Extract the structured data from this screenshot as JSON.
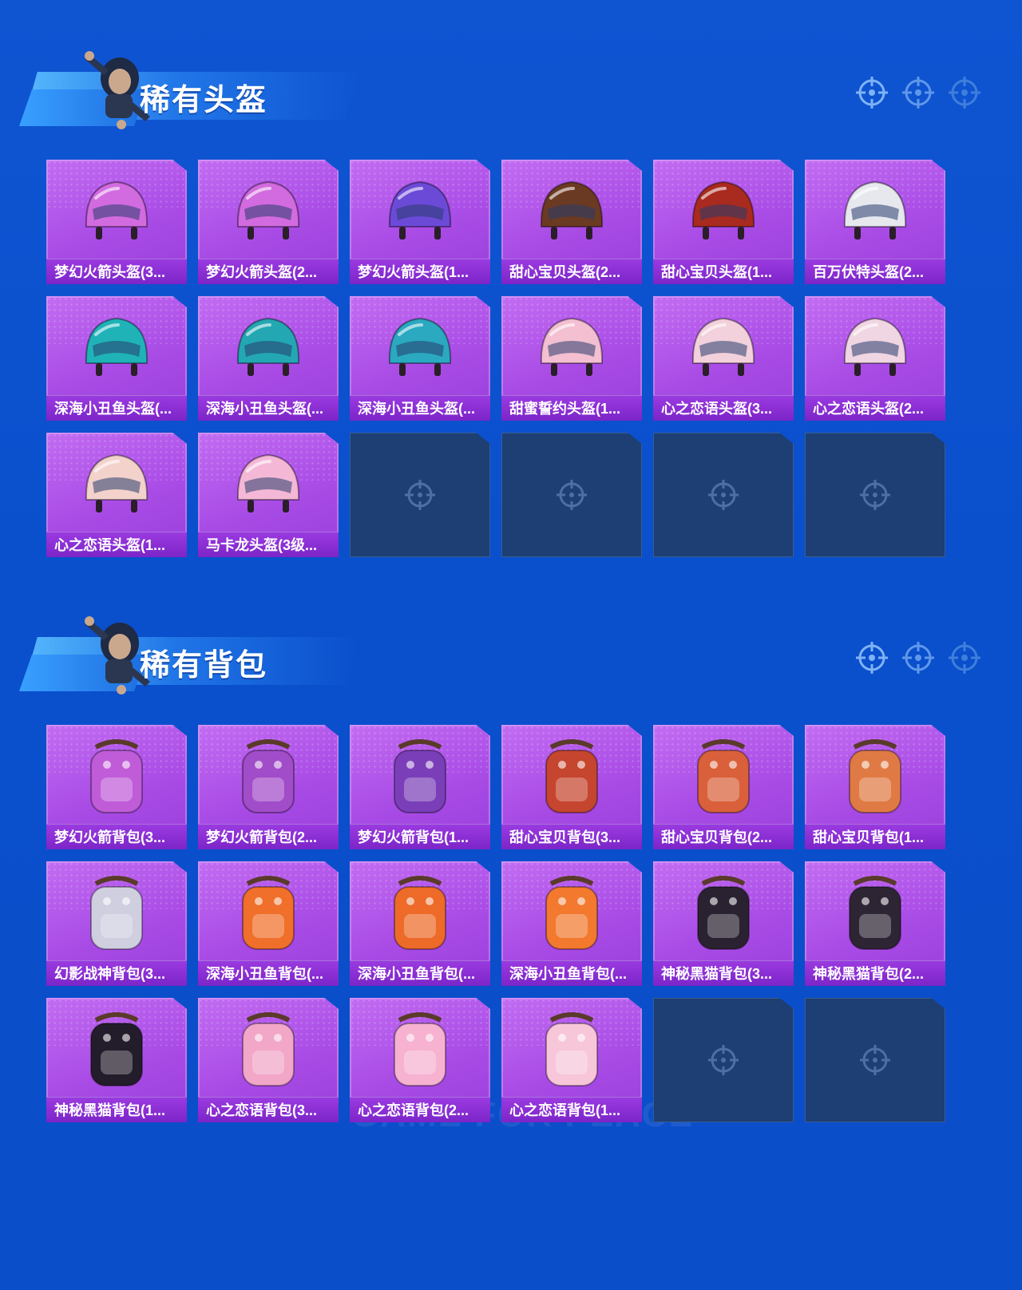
{
  "sections": [
    {
      "title": "稀有头盔",
      "items": [
        {
          "label": "梦幻火箭头盔(3...",
          "icon": "pink-rocket-helmet-icon",
          "color": "#d36be0"
        },
        {
          "label": "梦幻火箭头盔(2...",
          "icon": "pink-rocket-helmet-icon",
          "color": "#d36be0"
        },
        {
          "label": "梦幻火箭头盔(1...",
          "icon": "purple-open-helmet-icon",
          "color": "#6c4ad8"
        },
        {
          "label": "甜心宝贝头盔(2...",
          "icon": "chocolate-cake-helmet-icon",
          "color": "#6b3a22"
        },
        {
          "label": "甜心宝贝头盔(1...",
          "icon": "red-cherry-helmet-icon",
          "color": "#a92a1e"
        },
        {
          "label": "百万伏特头盔(2...",
          "icon": "white-cat-helmet-icon",
          "color": "#e6e8ee"
        },
        {
          "label": "深海小丑鱼头盔(...",
          "icon": "teal-level3-helmet-icon",
          "color": "#1fb3b8"
        },
        {
          "label": "深海小丑鱼头盔(...",
          "icon": "teal-level2-helmet-icon",
          "color": "#23a7b3"
        },
        {
          "label": "深海小丑鱼头盔(...",
          "icon": "teal-open-helmet-icon",
          "color": "#2aa9c0"
        },
        {
          "label": "甜蜜誓约头盔(1...",
          "icon": "pink-open-helmet-icon",
          "color": "#f3bfd1"
        },
        {
          "label": "心之恋语头盔(3...",
          "icon": "pink-shell-level3-helmet-icon",
          "color": "#f2d0dc"
        },
        {
          "label": "心之恋语头盔(2...",
          "icon": "pink-shell-level2-helmet-icon",
          "color": "#f0d6e2"
        },
        {
          "label": "心之恋语头盔(1...",
          "icon": "cream-open-helmet-icon",
          "color": "#f3d2cc"
        },
        {
          "label": "马卡龙头盔(3级...",
          "icon": "macaron-helmet-icon",
          "color": "#f4b8d6"
        }
      ],
      "empty_slots": 4
    },
    {
      "title": "稀有背包",
      "items": [
        {
          "label": "梦幻火箭背包(3...",
          "icon": "rocket-backpack-icon",
          "color": "#c05cd8"
        },
        {
          "label": "梦幻火箭背包(2...",
          "icon": "rocket-backpack-icon",
          "color": "#a14cc8"
        },
        {
          "label": "梦幻火箭背包(1...",
          "icon": "rocket-backpack-icon",
          "color": "#7a3fb8"
        },
        {
          "label": "甜心宝贝背包(3...",
          "icon": "cake-backpack-icon",
          "color": "#c5452e"
        },
        {
          "label": "甜心宝贝背包(2...",
          "icon": "cake-backpack-icon",
          "color": "#d9603a"
        },
        {
          "label": "甜心宝贝背包(1...",
          "icon": "cupcake-backpack-icon",
          "color": "#e07a45"
        },
        {
          "label": "幻影战神背包(3...",
          "icon": "phantom-backpack-icon",
          "color": "#cfcfe0"
        },
        {
          "label": "深海小丑鱼背包(...",
          "icon": "clownfish-backpack-icon",
          "color": "#f06f2a"
        },
        {
          "label": "深海小丑鱼背包(...",
          "icon": "clownfish-backpack-icon",
          "color": "#ee6a28"
        },
        {
          "label": "深海小丑鱼背包(...",
          "icon": "clownfish-backpack-icon",
          "color": "#f2792e"
        },
        {
          "label": "神秘黑猫背包(3...",
          "icon": "black-cat-backpack-icon",
          "color": "#2a2230"
        },
        {
          "label": "神秘黑猫背包(2...",
          "icon": "black-cat-backpack-icon",
          "color": "#2d2434"
        },
        {
          "label": "神秘黑猫背包(1...",
          "icon": "black-cat-backpack-icon",
          "color": "#231c2a"
        },
        {
          "label": "心之恋语背包(3...",
          "icon": "star-backpack-icon",
          "color": "#f2a6c8"
        },
        {
          "label": "心之恋语背包(2...",
          "icon": "pink-fluffy-backpack-icon",
          "color": "#f6b2d0"
        },
        {
          "label": "心之恋语背包(1...",
          "icon": "star-backpack-icon",
          "color": "#f7c6d8"
        }
      ],
      "empty_slots": 2
    }
  ],
  "watermark": "GAME FOR PEACE"
}
